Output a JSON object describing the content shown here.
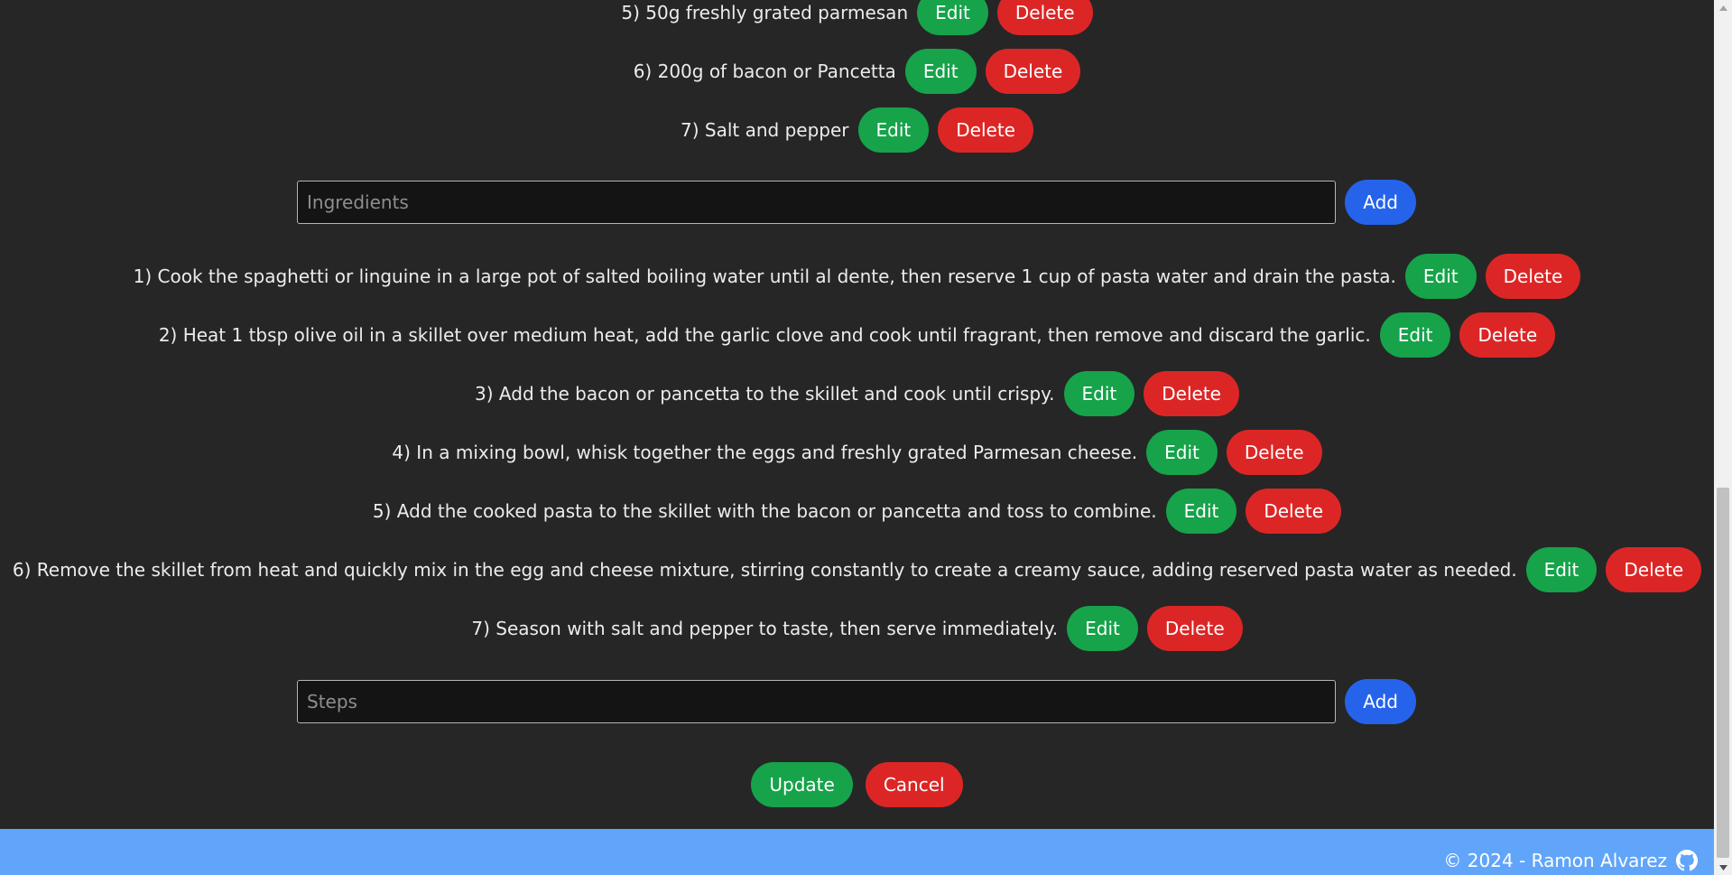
{
  "ingredients": {
    "items": [
      {
        "text": "5) 50g freshly grated parmesan"
      },
      {
        "text": "6) 200g of bacon or Pancetta"
      },
      {
        "text": "7) Salt and pepper"
      }
    ],
    "input_placeholder": "Ingredients",
    "add_label": "Add"
  },
  "steps": {
    "items": [
      {
        "text": "1) Cook the spaghetti or linguine in a large pot of salted boiling water until al dente, then reserve 1 cup of pasta water and drain the pasta."
      },
      {
        "text": "2) Heat 1 tbsp olive oil in a skillet over medium heat, add the garlic clove and cook until fragrant, then remove and discard the garlic."
      },
      {
        "text": "3) Add the bacon or pancetta to the skillet and cook until crispy."
      },
      {
        "text": "4) In a mixing bowl, whisk together the eggs and freshly grated Parmesan cheese."
      },
      {
        "text": "5) Add the cooked pasta to the skillet with the bacon or pancetta and toss to combine."
      },
      {
        "text": "6) Remove the skillet from heat and quickly mix in the egg and cheese mixture, stirring constantly to create a creamy sauce, adding reserved pasta water as needed."
      },
      {
        "text": "7) Season with salt and pepper to taste, then serve immediately."
      }
    ],
    "input_placeholder": "Steps",
    "add_label": "Add"
  },
  "item_buttons": {
    "edit_label": "Edit",
    "delete_label": "Delete"
  },
  "actions": {
    "update_label": "Update",
    "cancel_label": "Cancel"
  },
  "footer": {
    "text": "© 2024 - Ramon Alvarez",
    "icon": "github-icon"
  },
  "colors": {
    "background": "#262626",
    "edit": "#16a34a",
    "delete": "#dc2626",
    "add": "#2563eb",
    "footer": "#60a5fa"
  }
}
